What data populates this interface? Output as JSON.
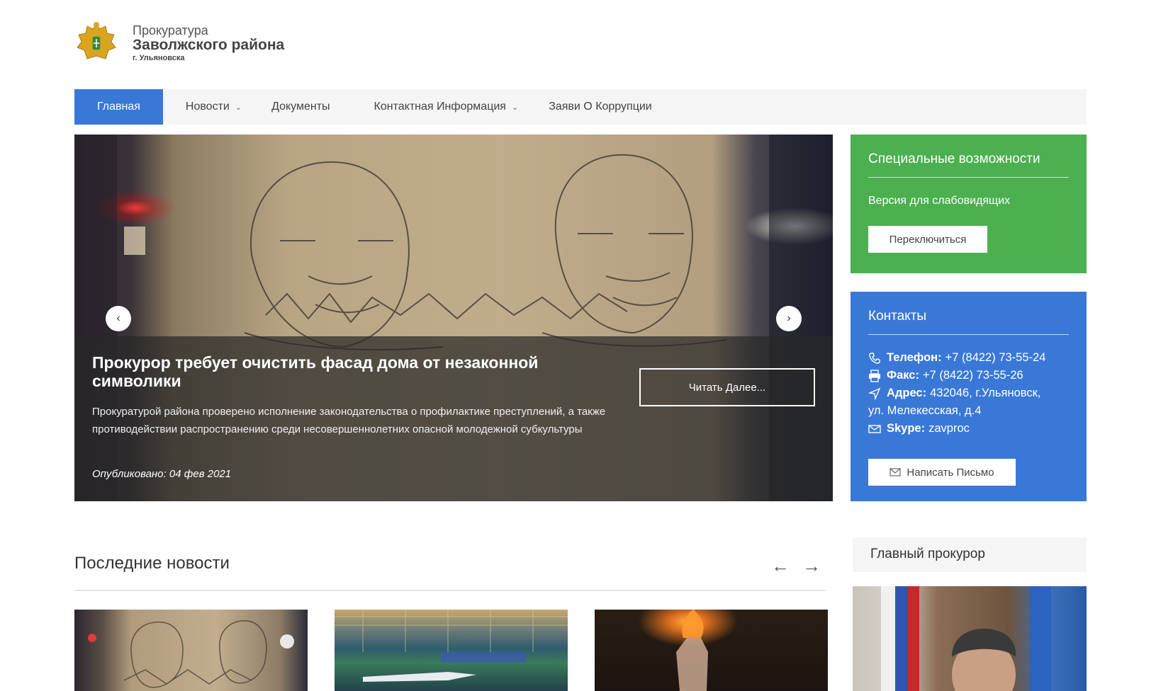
{
  "header": {
    "line1": "Прокуратура",
    "line2": "Заволжского района",
    "line3": "г. Ульяновска"
  },
  "nav": {
    "items": [
      {
        "label": "Главная",
        "active": true
      },
      {
        "label": "Новости",
        "dropdown": true
      },
      {
        "label": "Документы"
      },
      {
        "label": "Контактная Информация",
        "dropdown": true
      },
      {
        "label": "Заяви О Коррупции"
      }
    ]
  },
  "slider": {
    "title": "Прокурор требует очистить фасад дома от незаконной символики",
    "text": "Прокуратурой района проверено исполнение законодательства о профилактике преступлений, а также противодействии распространению среди несовершеннолетних опасной молодежной субкультуры",
    "date": "Опубликовано: 04 фев 2021",
    "read_more": "Читать Далее..."
  },
  "accessibility": {
    "title": "Специальные возможности",
    "subtitle": "Версия для слабовидящих",
    "button": "Переключиться"
  },
  "contacts": {
    "title": "Контакты",
    "phone_label": "Телефон:",
    "phone": "+7 (8422) 73-55-24",
    "fax_label": "Факс:",
    "fax": "+7 (8422) 73-55-26",
    "address_label": "Адрес:",
    "address_line1": "432046, г.Ульяновск,",
    "address_line2": "ул. Мелекесская, д.4",
    "skype_label": "Skype:",
    "skype": "zavproc",
    "button": "Написать Письмо"
  },
  "news": {
    "title": "Последние новости"
  },
  "chief": {
    "title": "Главный прокурор"
  },
  "colors": {
    "accent_blue": "#3a78d7",
    "accent_green": "#4caf50"
  }
}
